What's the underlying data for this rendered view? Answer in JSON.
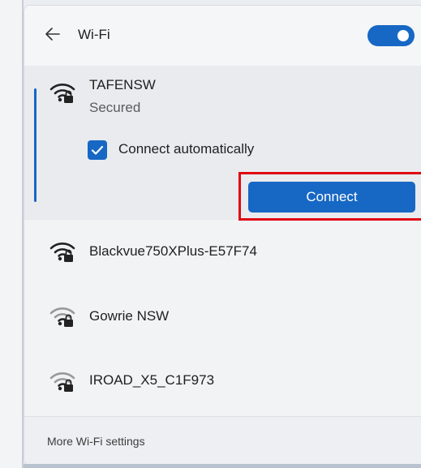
{
  "header": {
    "title": "Wi-Fi",
    "wifi_toggle": "on"
  },
  "expanded_network": {
    "name": "TAFENSW",
    "status": "Secured",
    "connect_automatically_label": "Connect automatically",
    "connect_automatically_checked": true,
    "connect_button_label": "Connect"
  },
  "networks": [
    {
      "name": "Blackvue750XPlus-E57F74",
      "icon": "wifi-secured-icon"
    },
    {
      "name": "Gowrie NSW",
      "icon": "wifi-secured-icon"
    },
    {
      "name": "IROAD_X5_C1F973",
      "icon": "wifi-secured-icon"
    }
  ],
  "footer": {
    "more_settings_label": "More Wi-Fi settings"
  },
  "colors": {
    "accent": "#1767c4",
    "highlight": "#e00612"
  }
}
